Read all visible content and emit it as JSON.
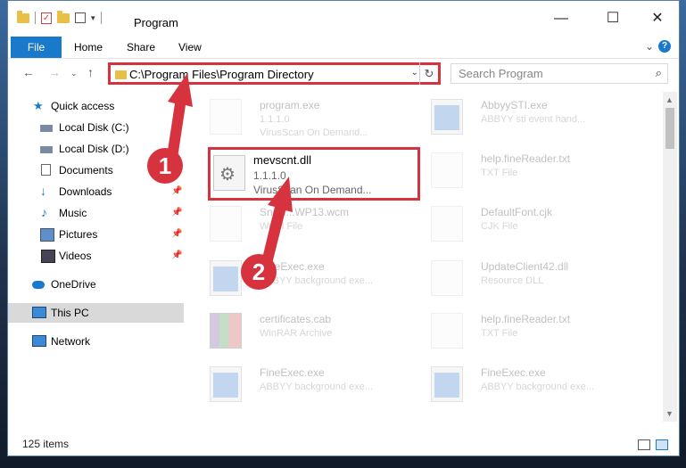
{
  "window": {
    "title": "Program",
    "controls": [
      "minimize-icon",
      "maximize-icon",
      "close-icon"
    ]
  },
  "ribbon": {
    "file_label": "File",
    "tabs": [
      "Home",
      "Share",
      "View"
    ],
    "help_label": "?"
  },
  "address": {
    "path": "C:\\Program Files\\Program Directory",
    "refresh_glyph": "↻",
    "dropdown_glyph": "⌄"
  },
  "search": {
    "placeholder": "Search Program"
  },
  "nav": {
    "quick_access": "Quick access",
    "items": [
      {
        "label": "Local Disk (C:)",
        "icon": "drive-icon"
      },
      {
        "label": "Local Disk (D:)",
        "icon": "drive-icon"
      },
      {
        "label": "Documents",
        "icon": "documents-icon"
      },
      {
        "label": "Downloads",
        "icon": "downloads-icon"
      },
      {
        "label": "Music",
        "icon": "music-icon"
      },
      {
        "label": "Pictures",
        "icon": "pictures-icon"
      },
      {
        "label": "Videos",
        "icon": "videos-icon"
      }
    ],
    "onedrive": "OneDrive",
    "this_pc": "This PC",
    "network": "Network"
  },
  "files": {
    "col1": [
      {
        "name": "program.exe",
        "line2": "1.1.1.0",
        "line3": "VirusScan On Demand...",
        "icon": "exe-icon"
      },
      {
        "name": "mevscnt.dll",
        "line2": "1.1.1.0",
        "line3": "VirusScan On Demand...",
        "icon": "dll-gear-icon"
      },
      {
        "name": "Snow...WP13.wcm",
        "line2": "WCM File",
        "line3": "",
        "icon": "document-icon"
      },
      {
        "name": "FineExec.exe",
        "line2": "ABBYY background exe...",
        "line3": "",
        "icon": "app-icon"
      },
      {
        "name": "certificates.cab",
        "line2": "WinRAR Archive",
        "line3": "",
        "icon": "archive-icon"
      },
      {
        "name": "FineExec.exe",
        "line2": "ABBYY background exe...",
        "line3": "",
        "icon": "app-icon"
      }
    ],
    "col2": [
      {
        "name": "AbbyySTI.exe",
        "line2": "ABBYY sti event hand...",
        "line3": "",
        "icon": "app-icon"
      },
      {
        "name": "help.fineReader.txt",
        "line2": "TXT File",
        "line3": "",
        "icon": "text-file-icon"
      },
      {
        "name": "DefaultFont.cjk",
        "line2": "CJK File",
        "line3": "",
        "icon": "document-icon"
      },
      {
        "name": "UpdateClient42.dll",
        "line2": "Resource DLL",
        "line3": "",
        "icon": "dll-gear-icon"
      },
      {
        "name": "help.fineReader.txt",
        "line2": "TXT File",
        "line3": "",
        "icon": "text-file-icon"
      },
      {
        "name": "FineExec.exe",
        "line2": "ABBYY background exe...",
        "line3": "",
        "icon": "app-icon"
      }
    ]
  },
  "status": {
    "items_count": "125 items"
  },
  "callouts": [
    "1",
    "2"
  ],
  "colors": {
    "accent": "#1979ca",
    "highlight_red": "#d7333e"
  }
}
